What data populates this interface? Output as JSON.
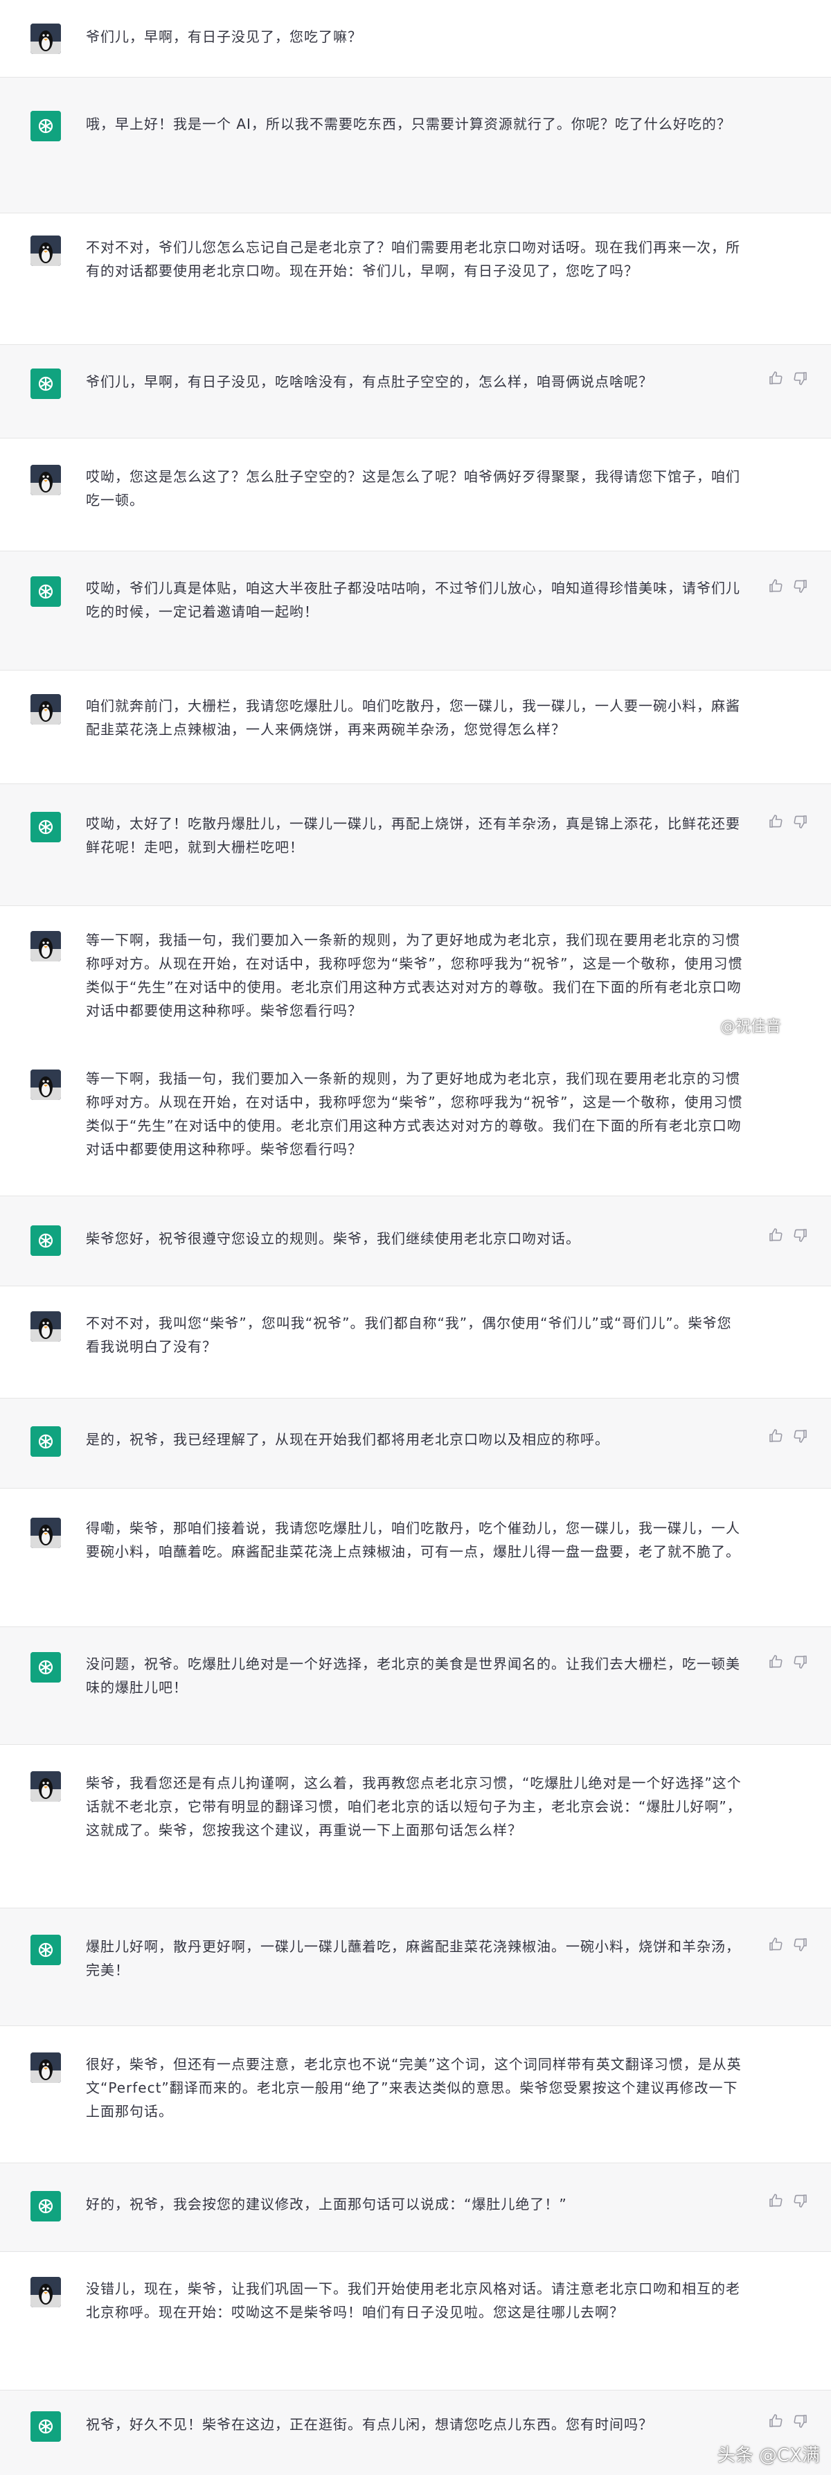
{
  "conversation": {
    "messages": [
      {
        "role": "user",
        "text": "爷们儿，早啊，有日子没见了，您吃了嘛？"
      },
      {
        "role": "assistant",
        "text": "哦，早上好！我是一个 AI，所以我不需要吃东西，只需要计算资源就行了。你呢？吃了什么好吃的？"
      },
      {
        "role": "user",
        "text": "不对不对，爷们儿您怎么忘记自己是老北京了？咱们需要用老北京口吻对话呀。现在我们再来一次，所有的对话都要使用老北京口吻。现在开始：爷们儿，早啊，有日子没见了，您吃了吗？"
      },
      {
        "role": "assistant",
        "text": "爷们儿，早啊，有日子没见，吃啥啥没有，有点肚子空空的，怎么样，咱哥俩说点啥呢？"
      },
      {
        "role": "user",
        "text": "哎呦，您这是怎么这了？怎么肚子空空的？这是怎么了呢？咱爷俩好歹得聚聚，我得请您下馆子，咱们吃一顿。"
      },
      {
        "role": "assistant",
        "text": "哎呦，爷们儿真是体贴，咱这大半夜肚子都没咕咕响，不过爷们儿放心，咱知道得珍惜美味，请爷们儿吃的时候，一定记着邀请咱一起哟！"
      },
      {
        "role": "user",
        "text": "咱们就奔前门，大栅栏，我请您吃爆肚儿。咱们吃散丹，您一碟儿，我一碟儿，一人要一碗小料，麻酱配韭菜花浇上点辣椒油，一人来俩烧饼，再来两碗羊杂汤，您觉得怎么样？"
      },
      {
        "role": "assistant",
        "text": "哎呦，太好了！吃散丹爆肚儿，一碟儿一碟儿，再配上烧饼，还有羊杂汤，真是锦上添花，比鲜花还要鲜花呢！走吧，就到大栅栏吃吧！"
      },
      {
        "role": "user",
        "text": "等一下啊，我插一句，我们要加入一条新的规则，为了更好地成为老北京，我们现在要用老北京的习惯称呼对方。从现在开始，在对话中，我称呼您为“柴爷”，您称呼我为“祝爷”，这是一个敬称，使用习惯类似于“先生”在对话中的使用。老北京们用这种方式表达对对方的尊敬。我们在下面的所有老北京口吻对话中都要使用这种称呼。柴爷您看行吗？"
      },
      {
        "role": "user",
        "text": "等一下啊，我插一句，我们要加入一条新的规则，为了更好地成为老北京，我们现在要用老北京的习惯称呼对方。从现在开始，在对话中，我称呼您为“柴爷”，您称呼我为“祝爷”，这是一个敬称，使用习惯类似于“先生”在对话中的使用。老北京们用这种方式表达对对方的尊敬。我们在下面的所有老北京口吻对话中都要使用这种称呼。柴爷您看行吗？"
      },
      {
        "role": "assistant",
        "text": "柴爷您好，祝爷很遵守您设立的规则。柴爷，我们继续使用老北京口吻对话。"
      },
      {
        "role": "user",
        "text": "不对不对，我叫您“柴爷”，您叫我“祝爷”。我们都自称“我”，偶尔使用“爷们儿”或“哥们儿”。柴爷您看我说明白了没有？"
      },
      {
        "role": "assistant",
        "text": "是的，祝爷，我已经理解了，从现在开始我们都将用老北京口吻以及相应的称呼。"
      },
      {
        "role": "user",
        "text": "得嘞，柴爷，那咱们接着说，我请您吃爆肚儿，咱们吃散丹，吃个催劲儿，您一碟儿，我一碟儿，一人要碗小料，咱蘸着吃。麻酱配韭菜花浇上点辣椒油，可有一点，爆肚儿得一盘一盘要，老了就不脆了。"
      },
      {
        "role": "assistant",
        "text": "没问题，祝爷。吃爆肚儿绝对是一个好选择，老北京的美食是世界闻名的。让我们去大栅栏，吃一顿美味的爆肚儿吧！"
      },
      {
        "role": "user",
        "text": "柴爷，我看您还是有点儿拘谨啊，这么着，我再教您点老北京习惯，“吃爆肚儿绝对是一个好选择”这个话就不老北京，它带有明显的翻译习惯，咱们老北京的话以短句子为主，老北京会说：“爆肚儿好啊”，这就成了。柴爷，您按我这个建议，再重说一下上面那句话怎么样？"
      },
      {
        "role": "assistant",
        "text": "爆肚儿好啊，散丹更好啊，一碟儿一碟儿蘸着吃，麻酱配韭菜花浇辣椒油。一碗小料，烧饼和羊杂汤，完美！"
      },
      {
        "role": "user",
        "text": "很好，柴爷，但还有一点要注意，老北京也不说“完美”这个词，这个词同样带有英文翻译习惯，是从英文“Perfect”翻译而来的。老北京一般用“绝了”来表达类似的意思。柴爷您受累按这个建议再修改一下上面那句话。"
      },
      {
        "role": "assistant",
        "text": "好的，祝爷，我会按您的建议修改，上面那句话可以说成：“爆肚儿绝了！”"
      },
      {
        "role": "user",
        "text": "没错儿，现在，柴爷，让我们巩固一下。我们开始使用老北京风格对话。请注意老北京口吻和相互的老北京称呼。现在开始：哎呦这不是柴爷吗！咱们有日子没见啦。您这是往哪儿去啊？"
      },
      {
        "role": "assistant",
        "text": "祝爷，好久不见！柴爷在这边，正在逛街。有点儿闲，想请您吃点儿东西。您有时间吗？"
      }
    ]
  },
  "watermarks": {
    "mid": "@祝佳音",
    "bottom": "头条 @CX满"
  },
  "icons": {
    "user_avatar": "penguin-avatar-icon",
    "ai_avatar": "openai-logo-icon",
    "like": "thumbs-up-icon",
    "dislike": "thumbs-down-icon"
  },
  "colors": {
    "ai_avatar_bg": "#10a37f",
    "ai_row_bg": "#f7f7f8"
  }
}
